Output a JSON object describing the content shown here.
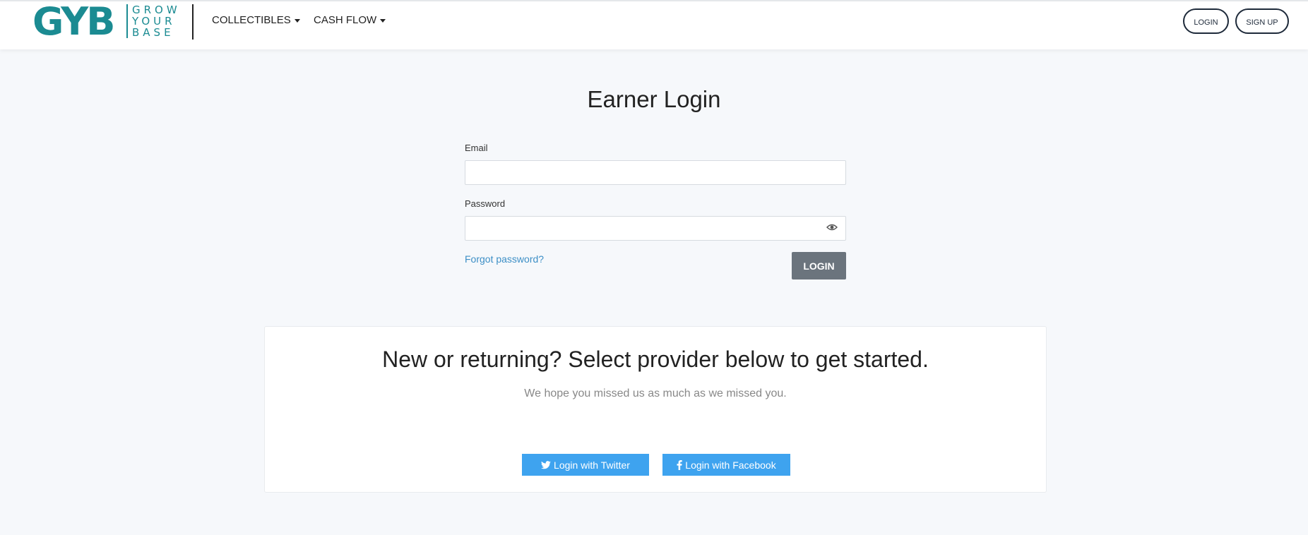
{
  "brand": {
    "mark": "GYB",
    "word_lines": [
      "GROW",
      "YOUR",
      "BASE"
    ],
    "color": "#1b8b92"
  },
  "nav": {
    "items": [
      {
        "label": "COLLECTIBLES",
        "icon": "caret-down-icon"
      },
      {
        "label": "CASH FLOW",
        "icon": "caret-down-icon"
      }
    ],
    "login_label": "LOGIN",
    "signup_label": "SIGN UP"
  },
  "login_form": {
    "title": "Earner Login",
    "email_label": "Email",
    "email_value": "",
    "password_label": "Password",
    "password_value": "",
    "password_toggle_icon": "eye-icon",
    "forgot_label": "Forgot password?",
    "submit_label": "LOGIN"
  },
  "provider_section": {
    "title": "New or returning? Select provider below to get started.",
    "subtitle": "We hope you missed us as much as we missed you.",
    "twitter_label": "Login with Twitter",
    "facebook_label": "Login with Facebook",
    "button_color": "#3ea3ef"
  },
  "colors": {
    "page_bg": "#f6f8fb",
    "link": "#3d8fc6",
    "login_button": "#6b747d"
  }
}
